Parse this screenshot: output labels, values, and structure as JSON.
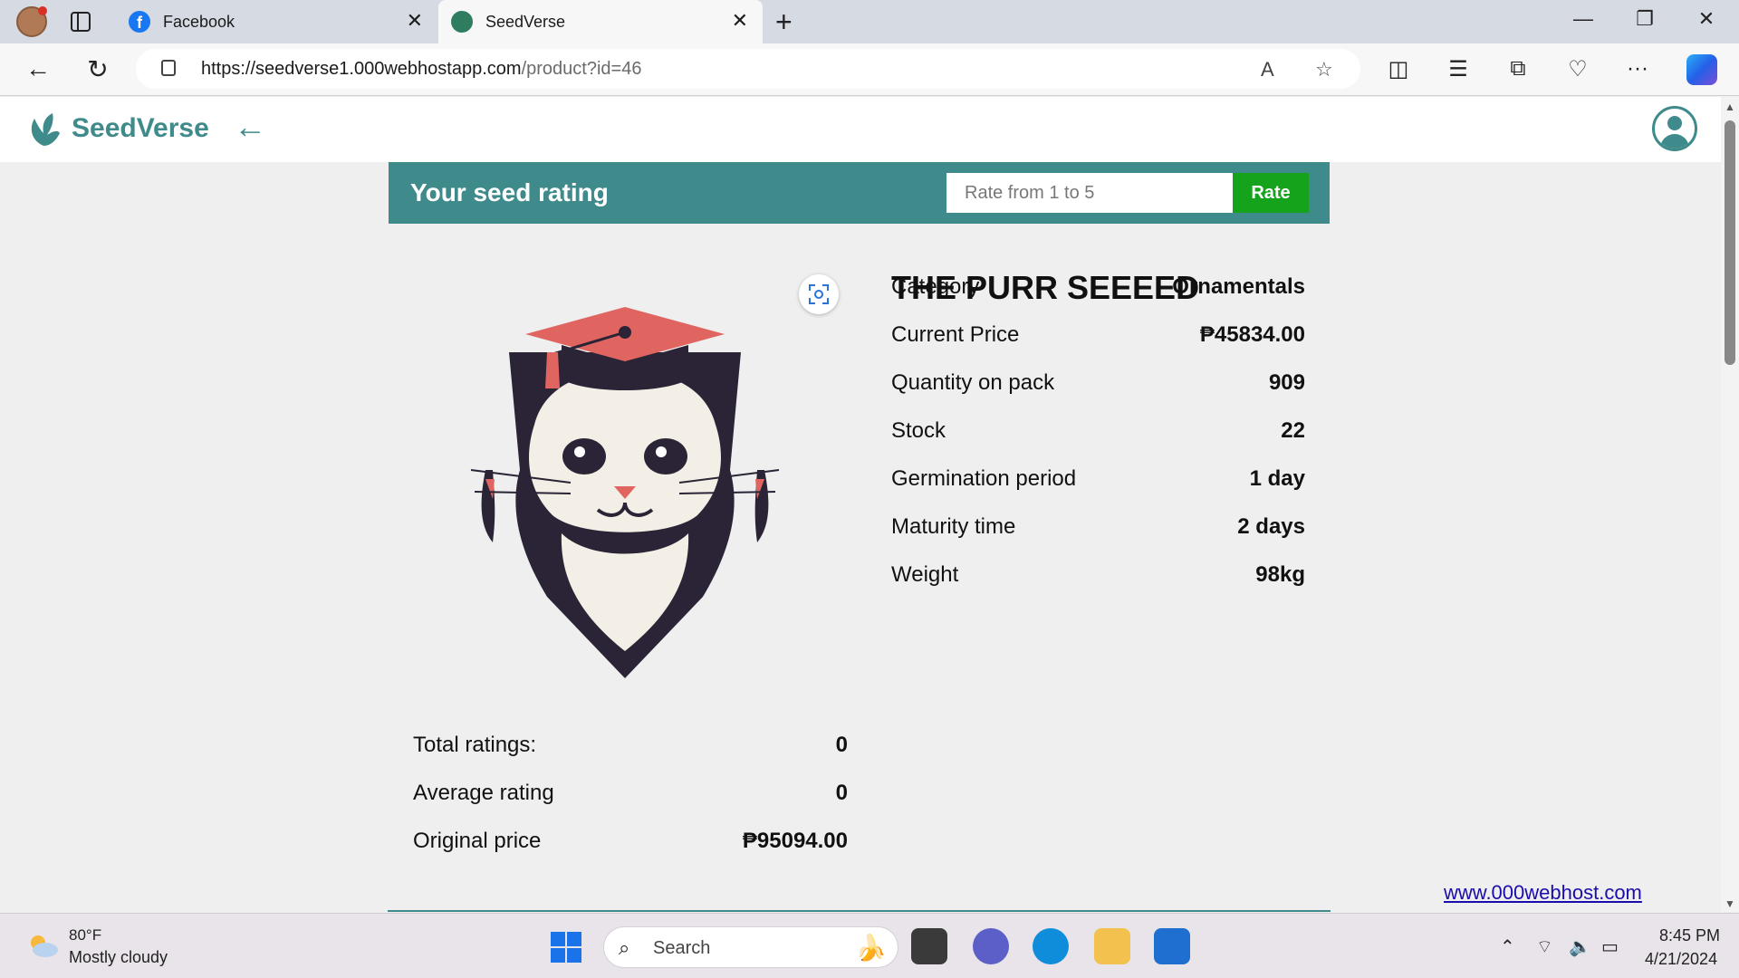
{
  "browser": {
    "tabs": [
      {
        "label": "Facebook"
      },
      {
        "label": "SeedVerse"
      }
    ],
    "url_scheme_host": "https://seedverse1.000webhostapp.com",
    "url_path": "/product?id=46"
  },
  "site": {
    "brand": "SeedVerse",
    "accent_color": "#3f8a8a"
  },
  "rating": {
    "title": "Your seed rating",
    "placeholder": "Rate from 1 to 5",
    "button": "Rate",
    "button_color": "#16a31c"
  },
  "product": {
    "title": "THE PURR SEEEED",
    "specs": [
      {
        "label": "Category",
        "value": "Ornamentals"
      },
      {
        "label": "Current Price",
        "value": "₱45834.00"
      },
      {
        "label": "Quantity on pack",
        "value": "909"
      },
      {
        "label": "Stock",
        "value": "22"
      },
      {
        "label": "Germination period",
        "value": "1 day"
      },
      {
        "label": "Maturity time",
        "value": "2 days"
      },
      {
        "label": "Weight",
        "value": "98kg"
      }
    ],
    "stats": [
      {
        "label": "Total ratings:",
        "value": "0"
      },
      {
        "label": "Average rating",
        "value": "0"
      },
      {
        "label": "Original price",
        "value": "₱95094.00"
      }
    ]
  },
  "footer_link": "www.000webhost.com",
  "taskbar": {
    "weather_temp": "80°F",
    "weather_desc": "Mostly cloudy",
    "search_placeholder": "Search",
    "time": "8:45 PM",
    "date": "4/21/2024"
  }
}
